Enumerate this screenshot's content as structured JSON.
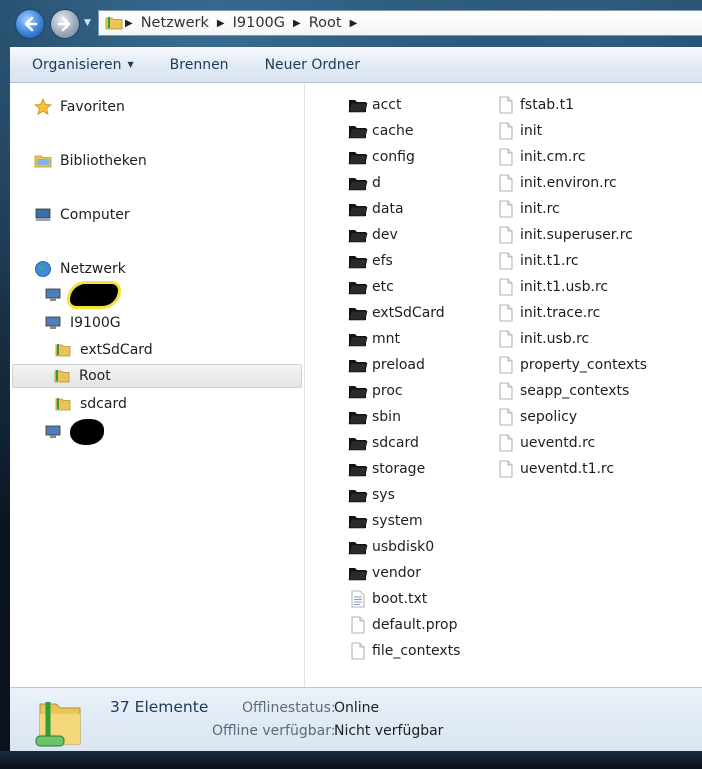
{
  "address": {
    "crumbs": [
      "Netzwerk",
      "I9100G",
      "Root"
    ]
  },
  "toolbar": {
    "organize_label": "Organisieren",
    "burn_label": "Brennen",
    "new_folder_label": "Neuer Ordner"
  },
  "nav": {
    "favorites": "Favoriten",
    "libraries": "Bibliotheken",
    "computer": "Computer",
    "network": "Netzwerk",
    "device": "I9100G",
    "ext_sdcard": "extSdCard",
    "root": "Root",
    "sdcard": "sdcard"
  },
  "files": {
    "folders": [
      "acct",
      "cache",
      "config",
      "d",
      "data",
      "dev",
      "efs",
      "etc",
      "extSdCard",
      "mnt",
      "preload",
      "proc",
      "sbin",
      "sdcard",
      "storage",
      "sys",
      "system",
      "usbdisk0",
      "vendor"
    ],
    "col1_files": [
      "boot.txt",
      "default.prop",
      "file_contexts"
    ],
    "col2_files": [
      "fstab.t1",
      "init",
      "init.cm.rc",
      "init.environ.rc",
      "init.rc",
      "init.superuser.rc",
      "init.t1.rc",
      "init.t1.usb.rc",
      "init.trace.rc",
      "init.usb.rc",
      "property_contexts",
      "seapp_contexts",
      "sepolicy",
      "ueventd.rc",
      "ueventd.t1.rc"
    ]
  },
  "status": {
    "count": "37 Elemente",
    "offline_status_label": "Offlinestatus:",
    "offline_status_value": "Online",
    "offline_available_label": "Offline verfügbar:",
    "offline_available_value": "Nicht verfügbar"
  },
  "colors": {
    "toolbar_text": "#1e395b",
    "folder_dark": "#141414",
    "selection_bg": "#e4e4e4"
  }
}
